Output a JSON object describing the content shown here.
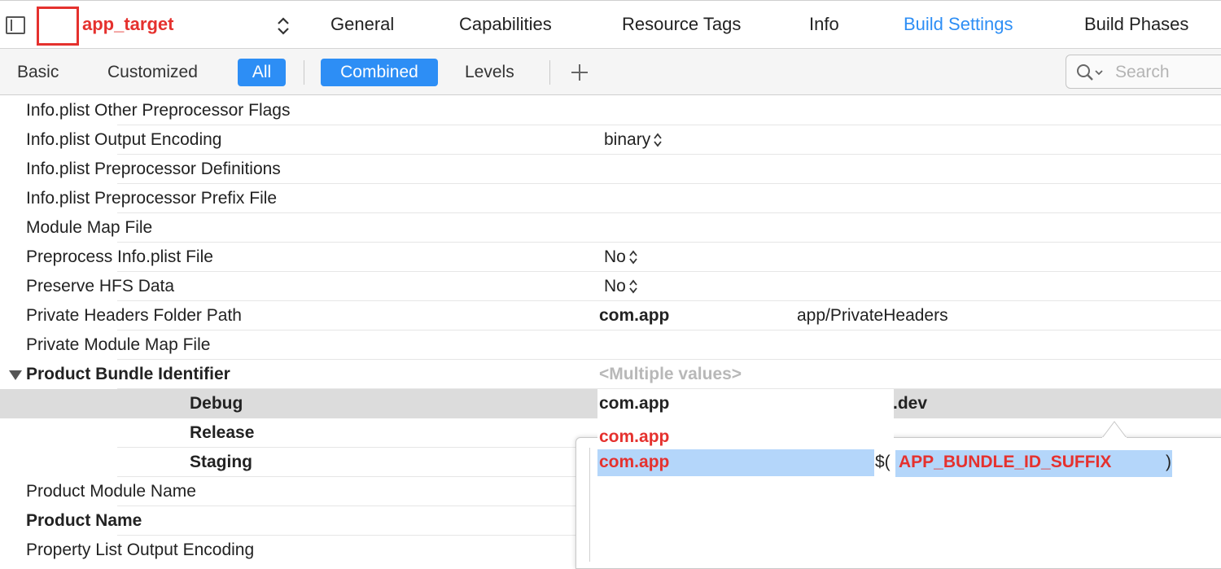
{
  "header": {
    "target_name": "app_target",
    "tabs": [
      "General",
      "Capabilities",
      "Resource Tags",
      "Info",
      "Build Settings",
      "Build Phases"
    ],
    "active_tab": "Build Settings"
  },
  "filters": {
    "basic": "Basic",
    "customized": "Customized",
    "all": "All",
    "combined": "Combined",
    "levels": "Levels",
    "search_placeholder": "Search"
  },
  "settings": [
    {
      "name": "Info.plist Other Preprocessor Flags",
      "value": ""
    },
    {
      "name": "Info.plist Output Encoding",
      "value": "binary"
    },
    {
      "name": "Info.plist Preprocessor Definitions",
      "value": ""
    },
    {
      "name": "Info.plist Preprocessor Prefix File",
      "value": ""
    },
    {
      "name": "Module Map File",
      "value": ""
    },
    {
      "name": "Preprocess Info.plist File",
      "value": "No"
    },
    {
      "name": "Preserve HFS Data",
      "value": "No"
    },
    {
      "name": "Private Headers Folder Path",
      "value": "com.app",
      "value_suffix": "app/PrivateHeaders"
    },
    {
      "name": "Private Module Map File",
      "value": ""
    },
    {
      "name": "Product Bundle Identifier",
      "value": "<Multiple values>"
    },
    {
      "name": "Debug",
      "value": "com.app",
      "value_suffix": ".dev"
    },
    {
      "name": "Release",
      "value": "com.app"
    },
    {
      "name": "Staging",
      "value": "com.app"
    },
    {
      "name": "Product Module Name",
      "value": ""
    },
    {
      "name": "Product Name",
      "value": ""
    },
    {
      "name": "Property List Output Encoding",
      "value": ""
    }
  ],
  "editor": {
    "line_prefix": "com.app",
    "macro_open": "$(",
    "macro_name": "APP_BUNDLE_ID_SUFFIX",
    "macro_close": ")"
  },
  "colors": {
    "accent": "#2d8ef5",
    "annotation_red": "#e5312e",
    "selection": "#b4d6fa"
  }
}
